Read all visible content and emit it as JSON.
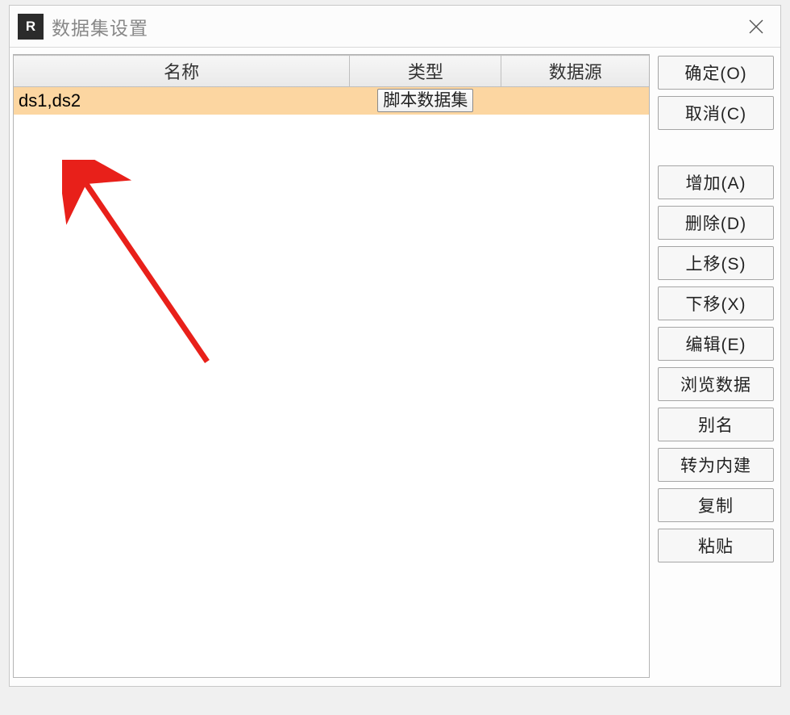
{
  "window": {
    "title": "数据集设置",
    "app_icon_letter": "R"
  },
  "table": {
    "headers": {
      "name": "名称",
      "type": "类型",
      "source": "数据源"
    },
    "rows": [
      {
        "name": "ds1,ds2",
        "type": "脚本数据集",
        "source": ""
      }
    ]
  },
  "buttons": {
    "ok": "确定(O)",
    "cancel": "取消(C)",
    "add": "增加(A)",
    "delete": "删除(D)",
    "move_up": "上移(S)",
    "move_down": "下移(X)",
    "edit": "编辑(E)",
    "browse": "浏览数据",
    "alias": "别名",
    "to_builtin": "转为内建",
    "copy": "复制",
    "paste": "粘贴"
  },
  "annotation": {
    "arrow_color": "#e8201a"
  }
}
